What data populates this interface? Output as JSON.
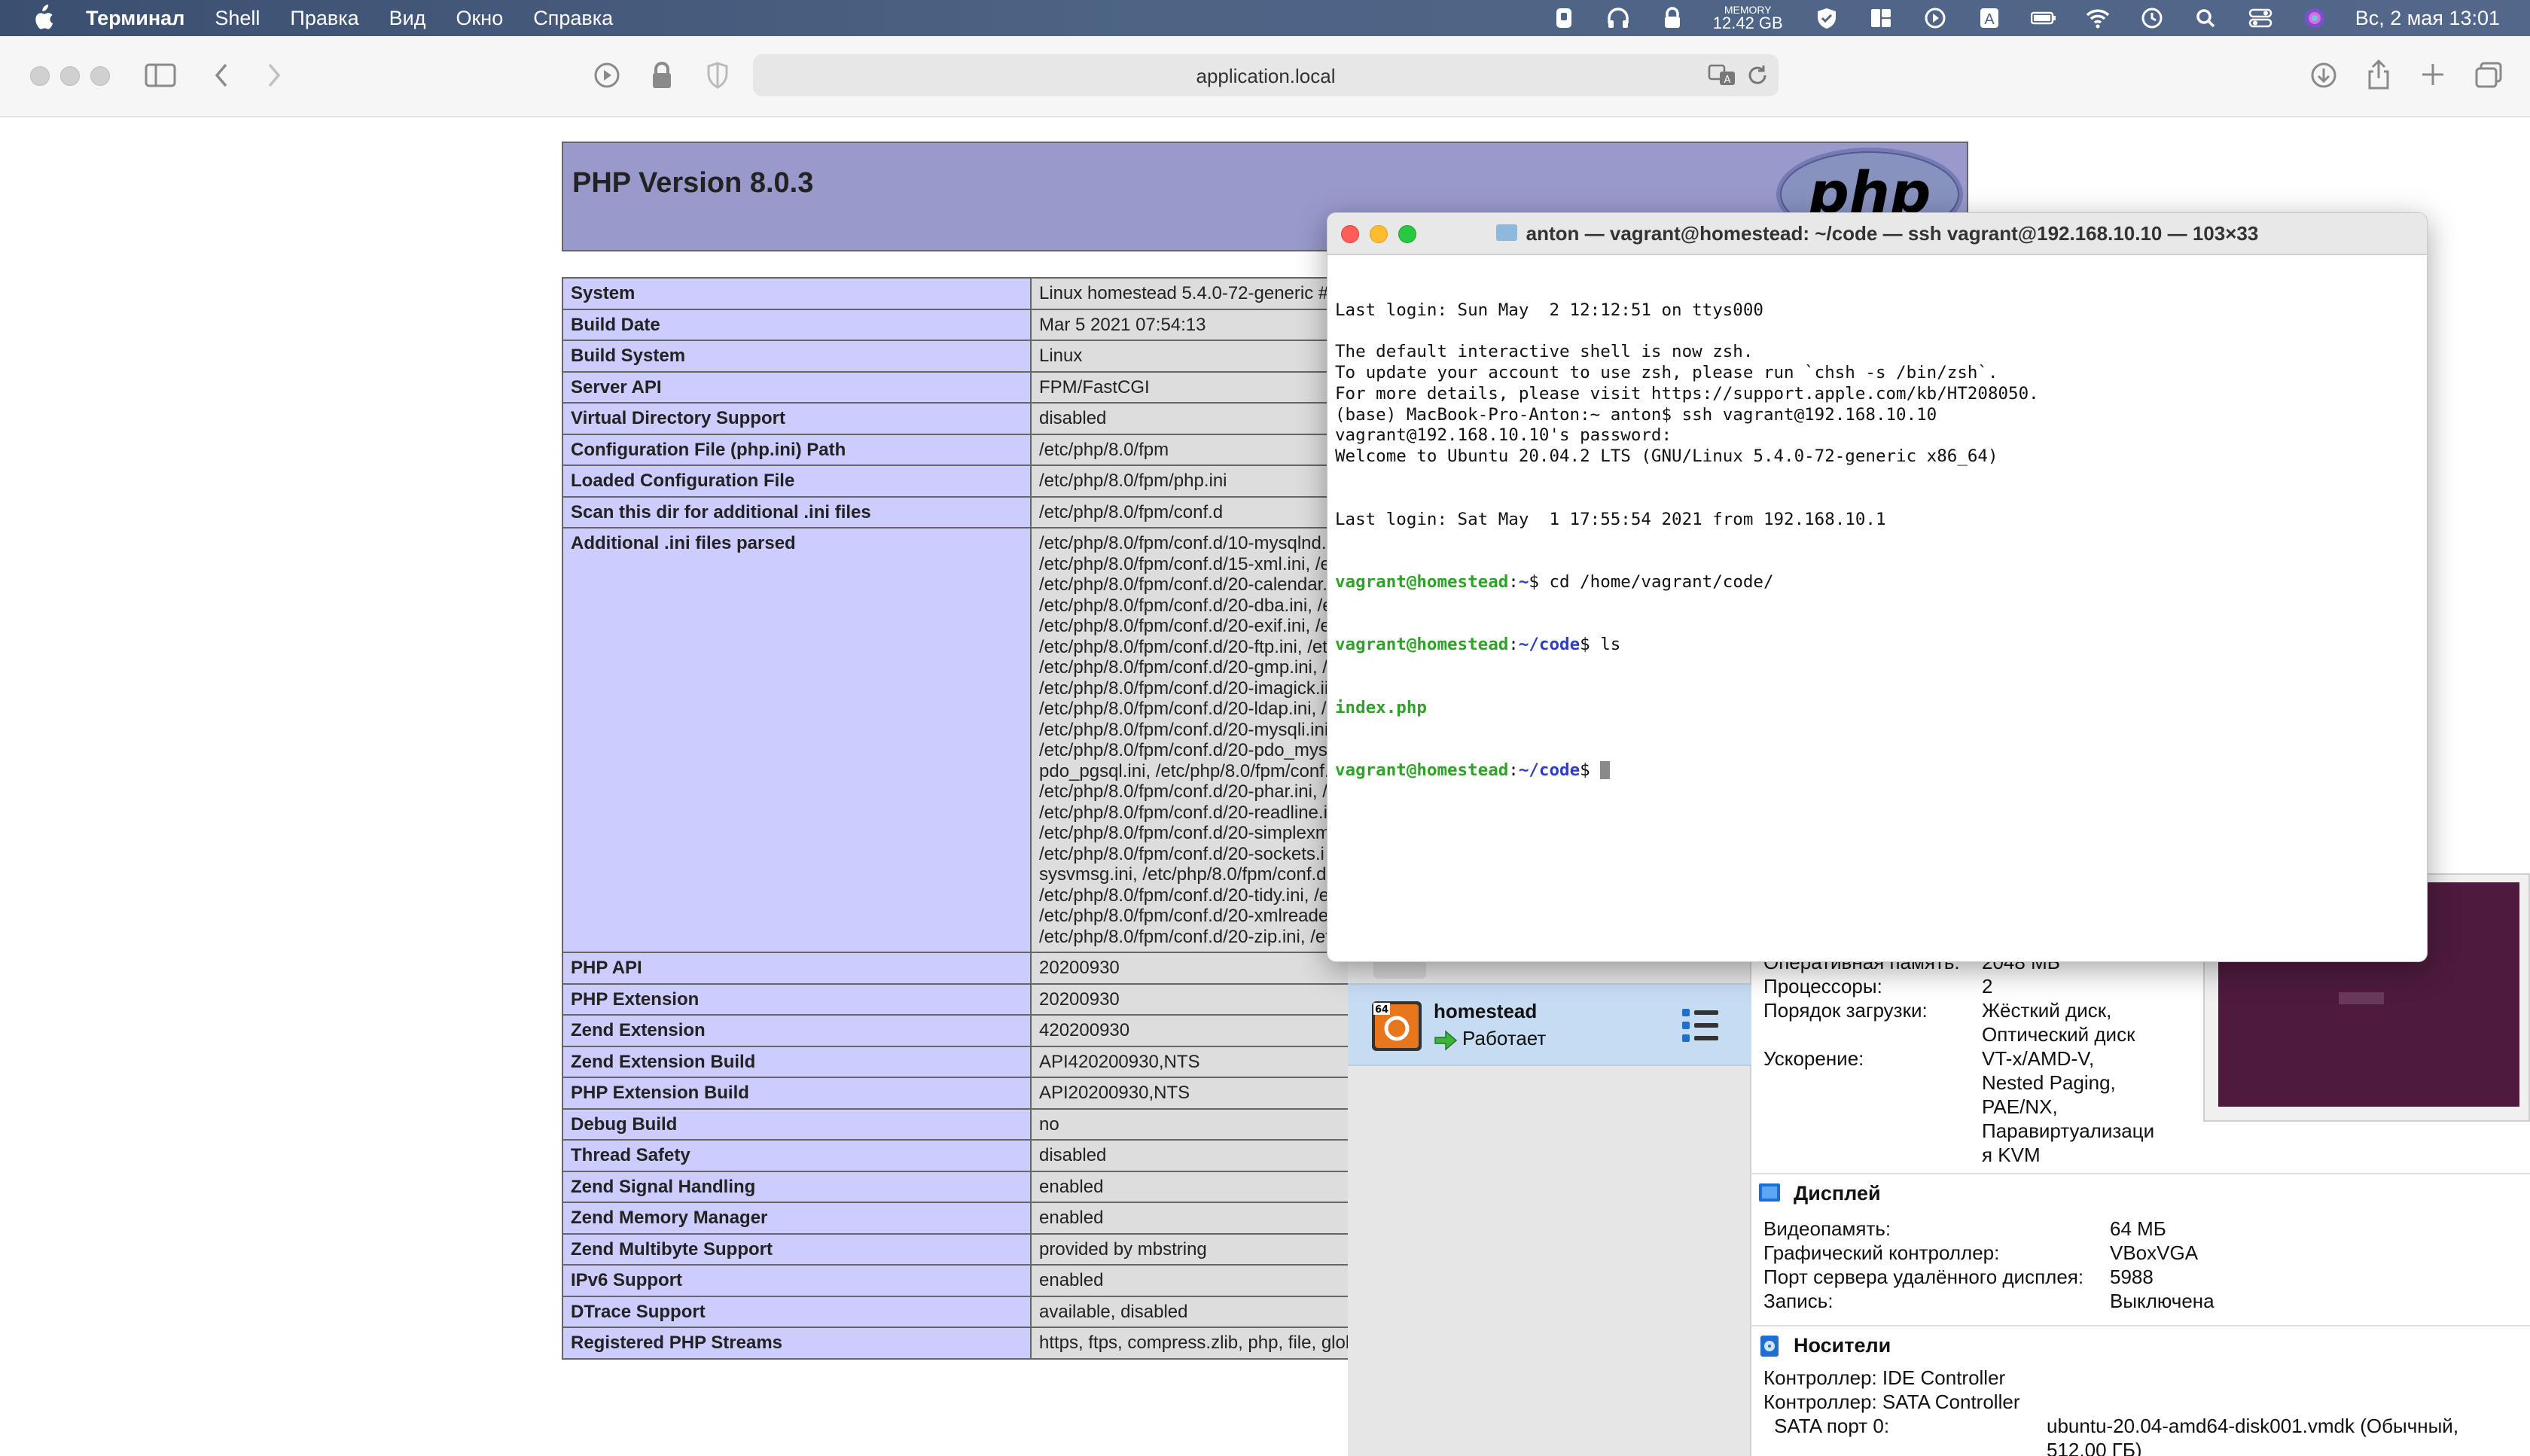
{
  "menubar": {
    "app_name": "Терминал",
    "menus": [
      "Shell",
      "Правка",
      "Вид",
      "Окно",
      "Справка"
    ],
    "memory_label": "MEMORY",
    "memory_value": "12.42 GB",
    "input_source": "A",
    "clock": "Вс, 2 мая  13:01"
  },
  "safari": {
    "address": "application.local"
  },
  "phpinfo": {
    "version_title": "PHP Version 8.0.3",
    "logo_text": "php",
    "rows": [
      {
        "key": "System",
        "value": "Linux homestead 5.4.0-72-generic #"
      },
      {
        "key": "Build Date",
        "value": "Mar 5 2021 07:54:13"
      },
      {
        "key": "Build System",
        "value": "Linux"
      },
      {
        "key": "Server API",
        "value": "FPM/FastCGI"
      },
      {
        "key": "Virtual Directory Support",
        "value": "disabled"
      },
      {
        "key": "Configuration File (php.ini) Path",
        "value": "/etc/php/8.0/fpm"
      },
      {
        "key": "Loaded Configuration File",
        "value": "/etc/php/8.0/fpm/php.ini"
      },
      {
        "key": "Scan this dir for additional .ini files",
        "value": "/etc/php/8.0/fpm/conf.d"
      }
    ],
    "additional_ini_key": "Additional .ini files parsed",
    "additional_ini_lines": [
      "/etc/php/8.0/fpm/conf.d/10-mysqlnd.",
      "/etc/php/8.0/fpm/conf.d/15-xml.ini, /e",
      "/etc/php/8.0/fpm/conf.d/20-calendar.",
      "/etc/php/8.0/fpm/conf.d/20-dba.ini, /e",
      "/etc/php/8.0/fpm/conf.d/20-exif.ini, /e",
      "/etc/php/8.0/fpm/conf.d/20-ftp.ini, /et",
      "/etc/php/8.0/fpm/conf.d/20-gmp.ini, /",
      "/etc/php/8.0/fpm/conf.d/20-imagick.ii",
      "/etc/php/8.0/fpm/conf.d/20-ldap.ini, /",
      "/etc/php/8.0/fpm/conf.d/20-mysqli.ini",
      "/etc/php/8.0/fpm/conf.d/20-pdo_mys",
      "pdo_pgsql.ini, /etc/php/8.0/fpm/conf.",
      "/etc/php/8.0/fpm/conf.d/20-phar.ini, /",
      "/etc/php/8.0/fpm/conf.d/20-readline.i",
      "/etc/php/8.0/fpm/conf.d/20-simplexm",
      "/etc/php/8.0/fpm/conf.d/20-sockets.i",
      "sysvmsg.ini, /etc/php/8.0/fpm/conf.d",
      "/etc/php/8.0/fpm/conf.d/20-tidy.ini, /e",
      "/etc/php/8.0/fpm/conf.d/20-xmlreader.i",
      "/etc/php/8.0/fpm/conf.d/20-zip.ini, /etc/p"
    ],
    "rows_after": [
      {
        "key": "PHP API",
        "value": "20200930"
      },
      {
        "key": "PHP Extension",
        "value": "20200930"
      },
      {
        "key": "Zend Extension",
        "value": "420200930"
      },
      {
        "key": "Zend Extension Build",
        "value": "API420200930,NTS"
      },
      {
        "key": "PHP Extension Build",
        "value": "API20200930,NTS"
      },
      {
        "key": "Debug Build",
        "value": "no"
      },
      {
        "key": "Thread Safety",
        "value": "disabled"
      },
      {
        "key": "Zend Signal Handling",
        "value": "enabled"
      },
      {
        "key": "Zend Memory Manager",
        "value": "enabled"
      },
      {
        "key": "Zend Multibyte Support",
        "value": "provided by mbstring"
      },
      {
        "key": "IPv6 Support",
        "value": "enabled"
      },
      {
        "key": "DTrace Support",
        "value": "available, disabled"
      },
      {
        "key": "Registered PHP Streams",
        "value": "https, ftps, compress.zlib, php, file, glob"
      }
    ]
  },
  "terminal": {
    "title": "anton — vagrant@homestead: ~/code — ssh vagrant@192.168.10.10 — 103×33",
    "lines": [
      "Last login: Sun May  2 12:12:51 on ttys000",
      "",
      "The default interactive shell is now zsh.",
      "To update your account to use zsh, please run `chsh -s /bin/zsh`.",
      "For more details, please visit https://support.apple.com/kb/HT208050.",
      "(base) MacBook-Pro-Anton:~ anton$ ssh vagrant@192.168.10.10",
      "vagrant@192.168.10.10's password:",
      "Welcome to Ubuntu 20.04.2 LTS (GNU/Linux 5.4.0-72-generic x86_64)",
      "",
      "",
      "Last login: Sat May  1 17:55:54 2021 from 192.168.10.1"
    ],
    "prompt_user": "vagrant@homestead",
    "prompt_sep": ":",
    "prompt_home": "~",
    "prompt_code": "~/code",
    "prompt_dollar": "$ ",
    "cmd1": "cd /home/vagrant/code/",
    "cmd2": "ls",
    "ls_output": "index.php"
  },
  "virtualbox": {
    "vm_name": "homestead",
    "vm_state": "Работает",
    "system": [
      {
        "label": "Оперативная память:",
        "value": "2048 МБ"
      },
      {
        "label": "Процессоры:",
        "value": "2"
      },
      {
        "label": "Порядок загрузки:",
        "value": "Жёсткий диск,"
      },
      {
        "label": "",
        "value": "Оптический диск"
      },
      {
        "label": "Ускорение:",
        "value": "VT-x/AMD-V,"
      },
      {
        "label": "",
        "value": "Nested Paging,"
      },
      {
        "label": "",
        "value": "PAE/NX,"
      },
      {
        "label": "",
        "value": "Паравиртуализаци"
      },
      {
        "label": "",
        "value": "я KVM"
      }
    ],
    "display_heading": "Дисплей",
    "display": [
      {
        "label": "Видеопамять:",
        "value": "64 МБ"
      },
      {
        "label": "Графический контроллер:",
        "value": "VBoxVGA"
      },
      {
        "label": "Порт сервера удалённого дисплея:",
        "value": "5988"
      },
      {
        "label": "Запись:",
        "value": "Выключена"
      }
    ],
    "storage_heading": "Носители",
    "storage_lines": [
      "Контроллер: IDE Controller",
      "Контроллер: SATA Controller"
    ],
    "sata_label": "SATA порт 0:",
    "sata_value": "ubuntu-20.04-amd64-disk001.vmdk (Обычный,",
    "sata_value2": "512,00 ГБ)"
  }
}
